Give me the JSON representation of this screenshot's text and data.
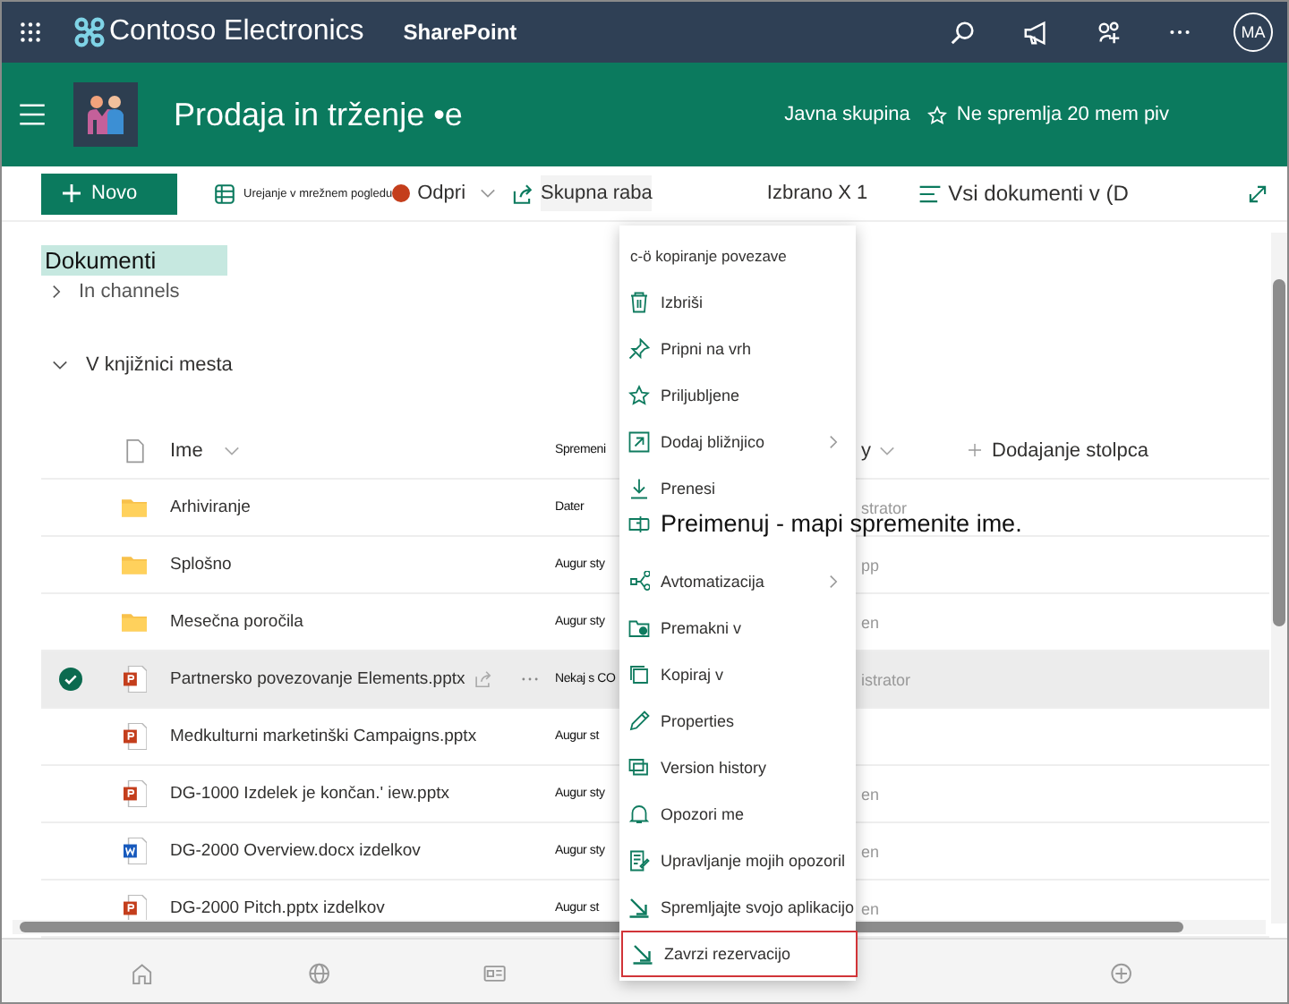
{
  "top_bar": {
    "brand": "Contoso Electronics",
    "app": "SharePoint",
    "avatar": "MA"
  },
  "site_header": {
    "title": "Prodaja in trženje •e",
    "group": "Javna skupina",
    "follow": "Ne spremlja 20 mem piv"
  },
  "command_bar": {
    "new": "Novo",
    "grid_edit": "Urejanje v mrežnem pogledu",
    "open": "Odpri",
    "share": "Skupna raba",
    "selected_count": "Izbrano X 1",
    "view": "Vsi dokumenti v (D"
  },
  "library": {
    "title": "Dokumenti",
    "channels": "In channels",
    "site_section": "V knjižnici mesta"
  },
  "table": {
    "columns": [
      "Ime",
      "Spremeni",
      "y",
      "Dodajanje stolpca"
    ],
    "rows": [
      {
        "kind": "folder",
        "name": "Arhiviranje",
        "modified": "Dater",
        "modified_by": "strator",
        "selected": false
      },
      {
        "kind": "folder",
        "name": "Splošno",
        "modified": "Augur sty",
        "modified_by": "pp",
        "selected": false
      },
      {
        "kind": "folder",
        "name": "Mesečna poročila",
        "modified": "Augur sty",
        "modified_by": "en",
        "selected": false
      },
      {
        "kind": "pptx",
        "name": "Partnersko povezovanje Elements.pptx",
        "modified": "Nekaj s CO",
        "modified_by": "istrator",
        "selected": true
      },
      {
        "kind": "pptx",
        "name": "Medkulturni marketinški Campaigns.pptx",
        "modified": "Augur st",
        "selected": false
      },
      {
        "kind": "pptx",
        "name": "DG-1000 Izdelek je končan.' iew.pptx",
        "modified": "Augur sty",
        "modified_by": "en",
        "selected": false
      },
      {
        "kind": "docx",
        "name": "DG-2000 Overview.docx izdelkov",
        "modified": "Augur sty",
        "modified_by": "en",
        "selected": false
      },
      {
        "kind": "pptx",
        "name": "DG-2000 Pitch.pptx izdelkov",
        "modified": "Augur st",
        "modified_by": "en",
        "selected": false
      }
    ]
  },
  "context_menu": [
    {
      "kind": "plain",
      "label": "c-ö kopiranje povezave",
      "submenu": false,
      "focused": false
    },
    {
      "kind": "item",
      "label": "Izbriši",
      "submenu": false,
      "focused": false
    },
    {
      "kind": "item",
      "label": "Pripni na vrh",
      "submenu": false,
      "focused": false
    },
    {
      "kind": "item",
      "label": "Priljubljene",
      "submenu": false,
      "focused": false
    },
    {
      "kind": "item",
      "label": "Dodaj bližnjico",
      "submenu": true,
      "focused": false
    },
    {
      "kind": "item",
      "label": "Prenesi",
      "submenu": false,
      "focused": false
    },
    {
      "kind": "callout",
      "label": "Preimenuj - mapi spremenite ime.",
      "submenu": false,
      "focused": false
    },
    {
      "kind": "item",
      "label": "Avtomatizacija",
      "submenu": true,
      "focused": false
    },
    {
      "kind": "item",
      "label": "Premakni v",
      "submenu": false,
      "focused": false
    },
    {
      "kind": "item",
      "label": "Kopiraj v",
      "submenu": false,
      "focused": false
    },
    {
      "kind": "item",
      "label": "Properties",
      "submenu": false,
      "focused": false
    },
    {
      "kind": "item",
      "label": "Version history",
      "submenu": false,
      "focused": false
    },
    {
      "kind": "item",
      "label": "Opozori me",
      "submenu": false,
      "focused": false
    },
    {
      "kind": "item",
      "label": "Upravljanje mojih opozoril",
      "submenu": false,
      "focused": false
    },
    {
      "kind": "item",
      "label": "Spremljajte svojo aplikacijo",
      "submenu": false,
      "focused": false
    },
    {
      "kind": "item",
      "label": "Zavrzi rezervacijo",
      "submenu": false,
      "focused": true
    }
  ]
}
